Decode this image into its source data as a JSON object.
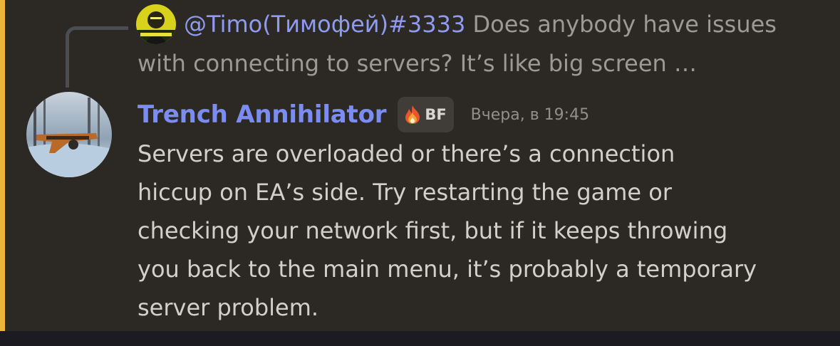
{
  "reply": {
    "author": "@Timo(Тимофей)#3333",
    "text_line1": " Does anybody have issues",
    "text_line2": "with connecting to servers? It’s like big screen …"
  },
  "message": {
    "author": "Trench Annihilator",
    "clan_tag": "BF",
    "timestamp": "Вчера, в 19:45",
    "lines": [
      "Servers are overloaded or there’s a connection",
      "hiccup on EA’s side. Try restarting the game or",
      "checking your network first, but if it keeps throwing",
      "you back to the main menu, it’s probably a temporary",
      "server problem."
    ]
  },
  "colors": {
    "background": "#2c2925",
    "accent_bar": "#f0b232",
    "reply_author": "#8f9bf0",
    "author": "#7b8df2",
    "message_text": "#d2d0cd",
    "muted_text": "#9c9a97"
  },
  "icons": {
    "reply_avatar": "cyberpunk-avatar-icon",
    "user_avatar": "tommy-gun-avatar-icon",
    "clan_badge": "flame-icon"
  }
}
